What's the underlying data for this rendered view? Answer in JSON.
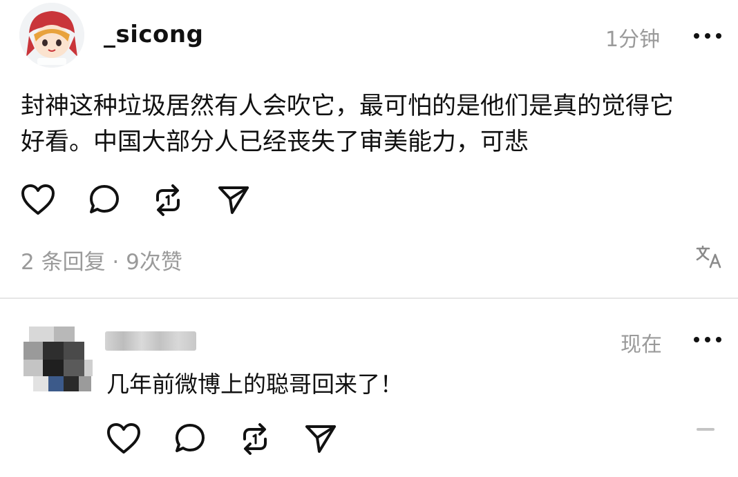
{
  "post": {
    "username": "_sicong",
    "time": "1分钟",
    "text_line1": "封神这种垃圾居然有人会吹它，最可怕的是他们是真的觉得它",
    "text_line2": "好看。中国大部分人已经丧失了审美能力，可悲",
    "stats": "2 条回复 · 9次赞",
    "actions": [
      "heart-icon",
      "comment-icon",
      "repost-icon",
      "share-icon"
    ]
  },
  "reply": {
    "time": "现在",
    "text": "几年前微博上的聪哥回来了！",
    "actions": [
      "heart-icon",
      "comment-icon",
      "repost-icon",
      "share-icon"
    ]
  },
  "colors": {
    "text": "#111111",
    "muted": "#9a9a9a",
    "divider": "#e6e6e6"
  }
}
